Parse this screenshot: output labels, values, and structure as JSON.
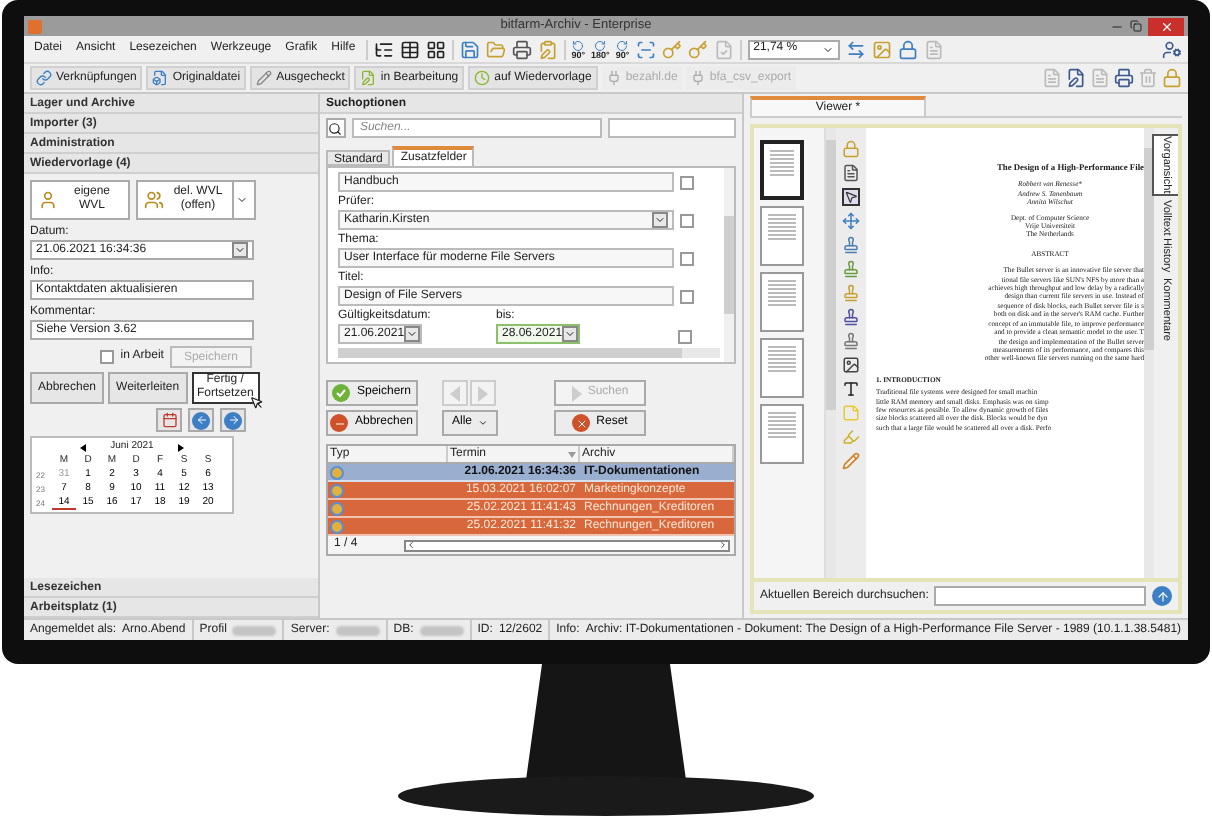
{
  "window": {
    "title": "bitfarm-Archiv - Enterprise"
  },
  "menu": [
    "Datei",
    "Ansicht",
    "Lesezeichen",
    "Werkzeuge",
    "Grafik",
    "Hilfe"
  ],
  "rotate_labels": [
    "90°",
    "180°",
    "90°"
  ],
  "zoom": {
    "value": "21,74 %"
  },
  "toolbar_buttons": [
    {
      "label": "Verknüpfungen",
      "disabled": false
    },
    {
      "label": "Originaldatei",
      "disabled": false
    },
    {
      "label": "Ausgecheckt",
      "disabled": false
    },
    {
      "label": "in Bearbeitung",
      "disabled": false
    },
    {
      "label": "auf Wiedervorlage",
      "disabled": false
    },
    {
      "label": "bezahl.de",
      "disabled": true
    },
    {
      "label": "bfa_csv_export",
      "disabled": true
    }
  ],
  "left_panel": {
    "sections_top": [
      "Lager und Archive",
      "Importer (3)",
      "Administration",
      "Wiedervorlage (4)"
    ],
    "wvl_buttons": [
      {
        "label": "eigene WVL",
        "kind": "plain"
      },
      {
        "label": "del. WVL (offen)",
        "kind": "split"
      }
    ],
    "fields": [
      {
        "label": "Datum:",
        "value": "21.06.2021 16:34:36",
        "kind": "dropdown"
      },
      {
        "label": "Info:",
        "value": "Kontaktdaten aktualisieren",
        "kind": "text"
      },
      {
        "label": "Kommentar:",
        "value": "Siehe Version 3.62",
        "kind": "text"
      }
    ],
    "in_arbeit": {
      "label": "in Arbeit",
      "checked": false
    },
    "save_button": {
      "label": "Speichern",
      "disabled": true
    },
    "action_buttons": [
      {
        "label": "Abbrechen",
        "hovered": false
      },
      {
        "label": "Weiterleiten",
        "hovered": false
      },
      {
        "label": "Fertig / Fortsetzen",
        "hovered": true
      }
    ],
    "calendar": {
      "month": "Juni 2021",
      "weekdays": [
        "M",
        "D",
        "M",
        "D",
        "F",
        "S",
        "S"
      ],
      "weeks": [
        {
          "number": "22",
          "days": [
            {
              "label": "31",
              "other_month": true,
              "today": false
            },
            {
              "label": "1",
              "other_month": false,
              "today": false
            },
            {
              "label": "2",
              "other_month": false,
              "today": false
            },
            {
              "label": "3",
              "other_month": false,
              "today": false
            },
            {
              "label": "4",
              "other_month": false,
              "today": false
            },
            {
              "label": "5",
              "other_month": false,
              "today": false
            },
            {
              "label": "6",
              "other_month": false,
              "today": false
            }
          ]
        },
        {
          "number": "23",
          "days": [
            {
              "label": "7",
              "other_month": false,
              "today": false
            },
            {
              "label": "8",
              "other_month": false,
              "today": false
            },
            {
              "label": "9",
              "other_month": false,
              "today": false
            },
            {
              "label": "10",
              "other_month": false,
              "today": false
            },
            {
              "label": "11",
              "other_month": false,
              "today": false
            },
            {
              "label": "12",
              "other_month": false,
              "today": false
            },
            {
              "label": "13",
              "other_month": false,
              "today": false
            }
          ]
        },
        {
          "number": "24",
          "days": [
            {
              "label": "14",
              "other_month": false,
              "today": true
            },
            {
              "label": "15",
              "other_month": false,
              "today": false
            },
            {
              "label": "16",
              "other_month": false,
              "today": false
            },
            {
              "label": "17",
              "other_month": false,
              "today": false
            },
            {
              "label": "18",
              "other_month": false,
              "today": false
            },
            {
              "label": "19",
              "other_month": false,
              "today": false
            },
            {
              "label": "20",
              "other_month": false,
              "today": false
            }
          ]
        }
      ]
    },
    "sections_bottom": [
      "Lesezeichen",
      "Arbeitsplatz (1)"
    ]
  },
  "search_panel": {
    "title": "Suchoptionen",
    "search": {
      "placeholder": "Suchen..."
    },
    "tabs": [
      {
        "label": "Standard",
        "selected": false
      },
      {
        "label": "Zusatzfelder",
        "selected": true
      }
    ],
    "fields": [
      {
        "kind": "text",
        "value": "Handbuch",
        "checked": false
      },
      {
        "kind": "dropdown",
        "label": "Prüfer:",
        "value": "Katharin.Kirsten",
        "checked": false
      },
      {
        "kind": "text",
        "label": "Thema:",
        "value": "User Interface für moderne File Servers",
        "checked": false
      },
      {
        "kind": "text",
        "label": "Titel:",
        "value": "Design of File Servers",
        "checked": false
      }
    ],
    "date_range": {
      "from": {
        "label": "Gültigkeitsdatum:",
        "value": "21.06.2021",
        "focused": false
      },
      "to": {
        "label": "bis:",
        "value": "28.06.2021",
        "focused": true
      },
      "checked": false
    },
    "buttons": [
      {
        "label": "Speichern",
        "kind": "save",
        "disabled": false
      },
      {
        "label": "Suchen",
        "kind": "search",
        "disabled": true
      },
      {
        "label": "Abbrechen",
        "kind": "cancel",
        "disabled": false
      },
      {
        "label": "Alle",
        "kind": "dropdown",
        "disabled": false
      },
      {
        "label": "Reset",
        "kind": "reset",
        "disabled": false
      }
    ],
    "table": {
      "columns": [
        "Typ",
        "Termin",
        "Archiv"
      ],
      "rows": [
        {
          "termin": "21.06.2021 16:34:36",
          "archiv": "IT-Dokumentationen",
          "selected": true
        },
        {
          "termin": "15.03.2021 16:02:07",
          "archiv": "Marketingkonzepte",
          "selected": false
        },
        {
          "termin": "25.02.2021 11:41:43",
          "archiv": "Rechnungen_Kreditoren",
          "selected": false
        },
        {
          "termin": "25.02.2021 11:41:32",
          "archiv": "Rechnungen_Kreditoren",
          "selected": false
        }
      ]
    },
    "pager": "1 / 4"
  },
  "viewer": {
    "tab": "Viewer *",
    "document": {
      "title": "The Design of a High-Performance File",
      "authors": [
        "Robbert van Renesse*",
        "Andrew S. Tanenbaum",
        "Annita Wilschut"
      ],
      "affiliation": [
        "Dept. of Computer Science",
        "Vrije Universiteit",
        "The Netherlands"
      ],
      "abstract_heading": "ABSTRACT",
      "abstract": [
        "The Bullet server is an innovative file server that",
        "tional file servers like SUN's NFS by more than a",
        "achieves high throughput and low delay by a radically",
        "design than current file servers in use. Instead of",
        "sequence of disk blocks, each Bullet server file is s",
        "both on disk and in the server's RAM cache. Further",
        "concept of an immutable file, to improve performance",
        "and to provide a clean semantic model to the user. T",
        "the design and implementation of the Bullet server",
        "measurements of its performance, and compares this",
        "other well-known file servers running on the same hard"
      ],
      "section_heading": "1. INTRODUCTION",
      "intro": [
        "Traditional file systems were designed for small machin",
        "little RAM memory and small disks. Emphasis was on simp",
        "few resources as possible. To allow dynamic growth of files",
        "size blocks scattered all over the disk. Blocks would be dyn",
        "such that a large file would be scattered all over a disk. Perfo"
      ]
    },
    "side_tabs": [
      {
        "label": "Vorgansicht",
        "selected": true
      },
      {
        "label": "Volltext",
        "selected": false
      },
      {
        "label": "History",
        "selected": false
      },
      {
        "label": "Kommentare",
        "selected": false
      }
    ],
    "search_label": "Aktuellen Bereich durchsuchen:"
  },
  "status_bar": [
    {
      "label": "Angemeldet als:",
      "value": "Arno.Abend",
      "kind": "text"
    },
    {
      "label": "Profil",
      "kind": "redacted"
    },
    {
      "label": "Server:",
      "kind": "redacted"
    },
    {
      "label": "DB:",
      "kind": "redacted"
    },
    {
      "label": "ID:",
      "value": "12/2602",
      "kind": "text"
    },
    {
      "label": "Info:",
      "value": "Archiv: IT-Dokumentationen - Dokument: The Design of a High-Performance File Server - 1989 (10.1.1.38.5481)",
      "kind": "text"
    }
  ]
}
